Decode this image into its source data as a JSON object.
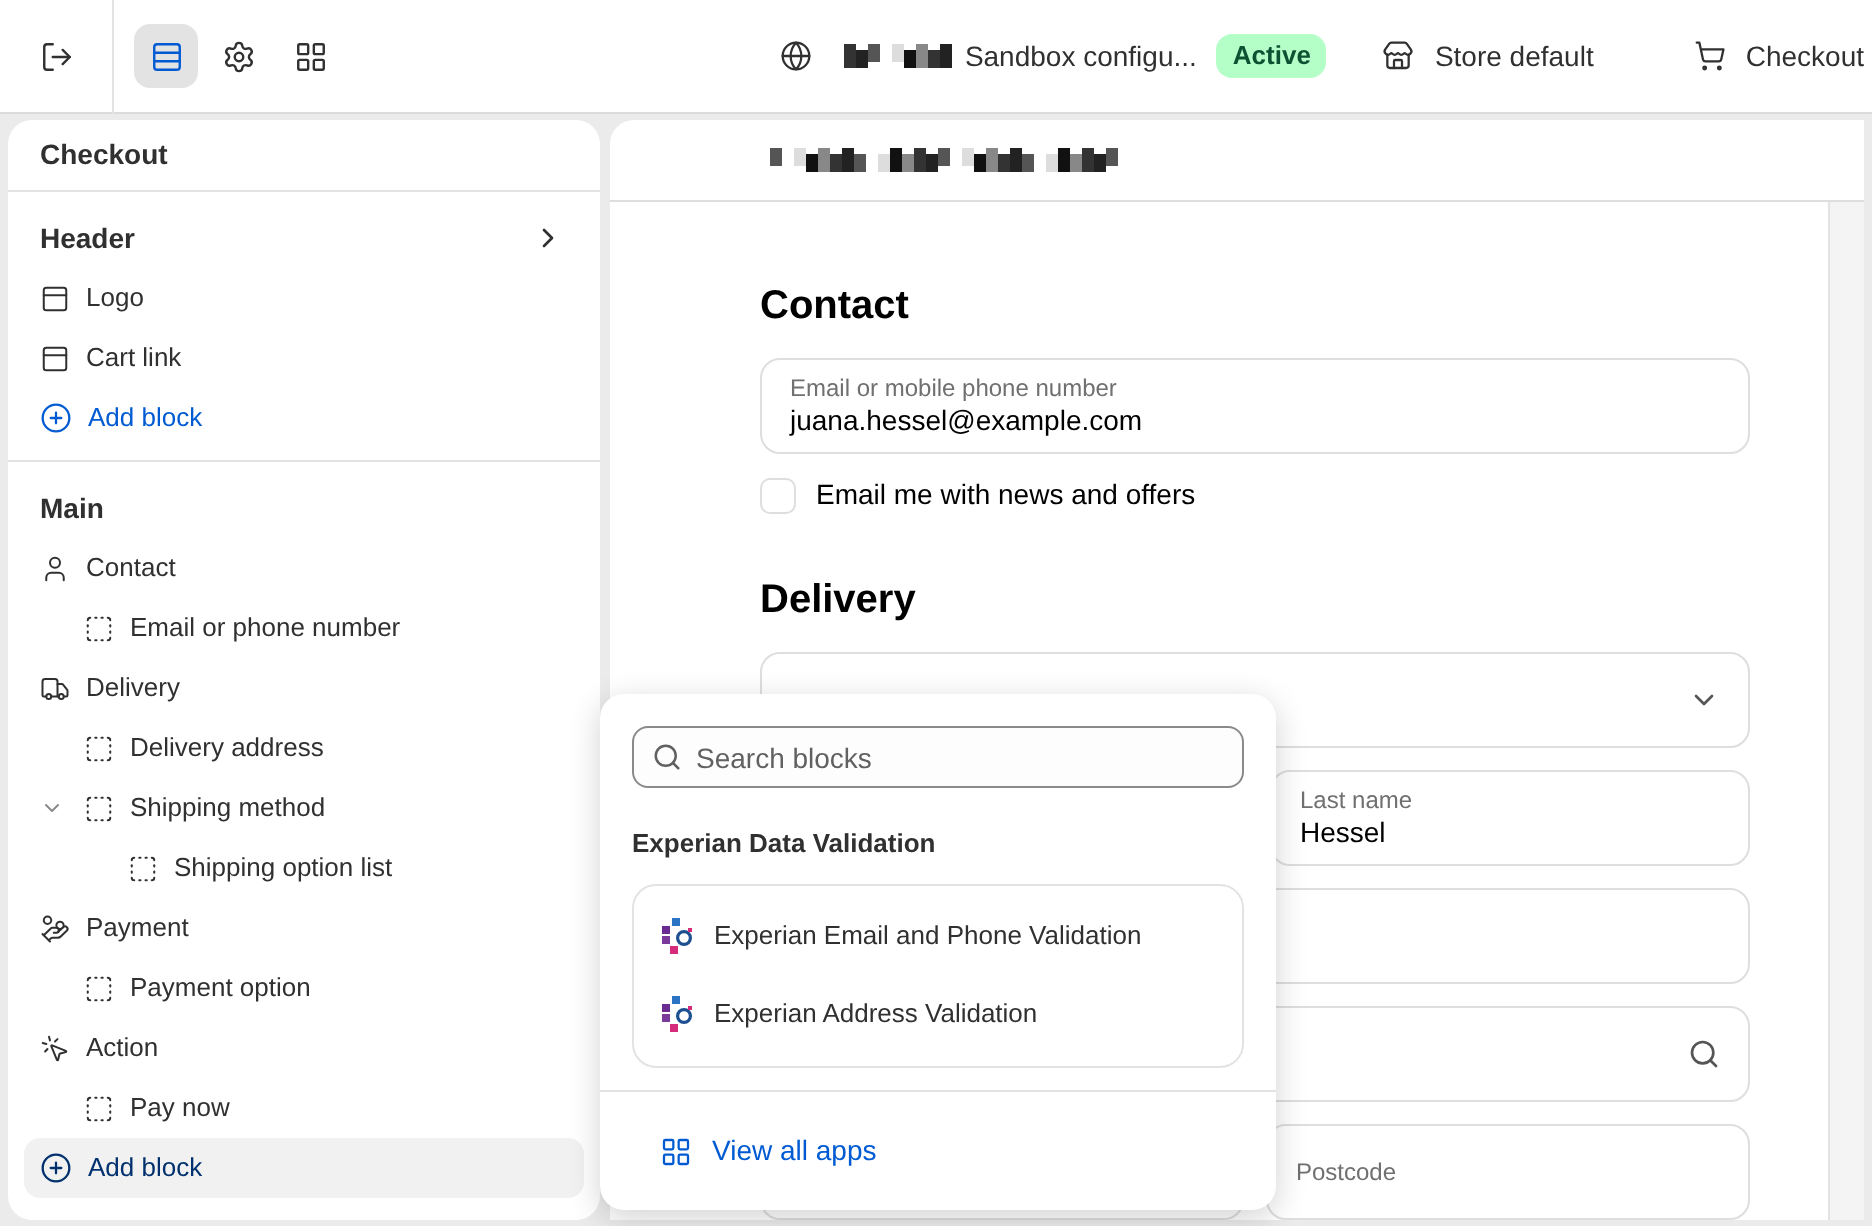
{
  "toolbar": {
    "tools": [
      {
        "kind": "exit",
        "selected": false
      },
      {
        "kind": "layout",
        "selected": true
      },
      {
        "kind": "settings",
        "selected": false
      },
      {
        "kind": "apps",
        "selected": false
      }
    ],
    "store_name": "Sandbox configu...",
    "status": "Active",
    "theme": "Store default",
    "page": "Checkout"
  },
  "sidebar": {
    "title": "Checkout",
    "sections": [
      {
        "title": "Header",
        "expandable": true,
        "items": [
          {
            "label": "Logo",
            "kind": "header-block"
          },
          {
            "label": "Cart link",
            "kind": "header-block"
          }
        ],
        "add_label": "Add block",
        "add_selected": false
      },
      {
        "title": "Main",
        "expandable": false,
        "items": [
          {
            "label": "Contact",
            "kind": "person",
            "children": [
              {
                "label": "Email or phone number",
                "kind": "block"
              }
            ]
          },
          {
            "label": "Delivery",
            "kind": "truck",
            "children": [
              {
                "label": "Delivery address",
                "kind": "block"
              },
              {
                "label": "Shipping method",
                "kind": "block",
                "expanded": true,
                "children": [
                  {
                    "label": "Shipping option list",
                    "kind": "block"
                  }
                ]
              }
            ]
          },
          {
            "label": "Payment",
            "kind": "hand-card",
            "children": [
              {
                "label": "Payment option",
                "kind": "block"
              }
            ]
          },
          {
            "label": "Action",
            "kind": "cursor",
            "children": [
              {
                "label": "Pay now",
                "kind": "block"
              }
            ]
          }
        ],
        "add_label": "Add block",
        "add_selected": true
      }
    ]
  },
  "preview": {
    "contact": {
      "heading": "Contact",
      "email_field": {
        "label": "Email or mobile phone number",
        "value": "juana.hessel@example.com"
      },
      "newsletter": {
        "label": "Email me with news and offers",
        "checked": false
      }
    },
    "delivery": {
      "heading": "Delivery",
      "rows": [
        [
          {
            "kind": "select"
          }
        ],
        [
          {
            "kind": "half-text",
            "label": "Last name",
            "value": "Hessel"
          }
        ],
        [
          {
            "kind": "text"
          }
        ],
        [
          {
            "kind": "search"
          }
        ],
        [
          {
            "kind": "text"
          },
          {
            "kind": "text",
            "label": "Postcode"
          }
        ]
      ]
    }
  },
  "block_picker": {
    "search": {
      "placeholder": "Search blocks"
    },
    "group": "Experian Data Validation",
    "apps": [
      {
        "label": "Experian Email and Phone Validation"
      },
      {
        "label": "Experian Address Validation"
      }
    ],
    "footer_link": "View all apps"
  }
}
